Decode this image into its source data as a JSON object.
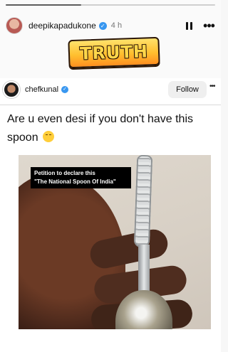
{
  "story": {
    "progress": 0.36,
    "username": "deepikapadukone",
    "time": "4 h",
    "sticker_text": "TRUTH"
  },
  "post": {
    "author": "chefkunal",
    "follow_label": "Follow",
    "caption_line1": "Are u even desi if you don't have this",
    "caption_line2": "spoon",
    "image_label_line1": "Petition to declare this",
    "image_label_line2": "\"The National Spoon Of India\""
  },
  "colors": {
    "verified": "#3897f0",
    "sticker": "#ffbf2f"
  },
  "icons": [
    "avatar",
    "verified-icon",
    "pause-icon",
    "more-icon",
    "smiling-emoji-icon"
  ]
}
